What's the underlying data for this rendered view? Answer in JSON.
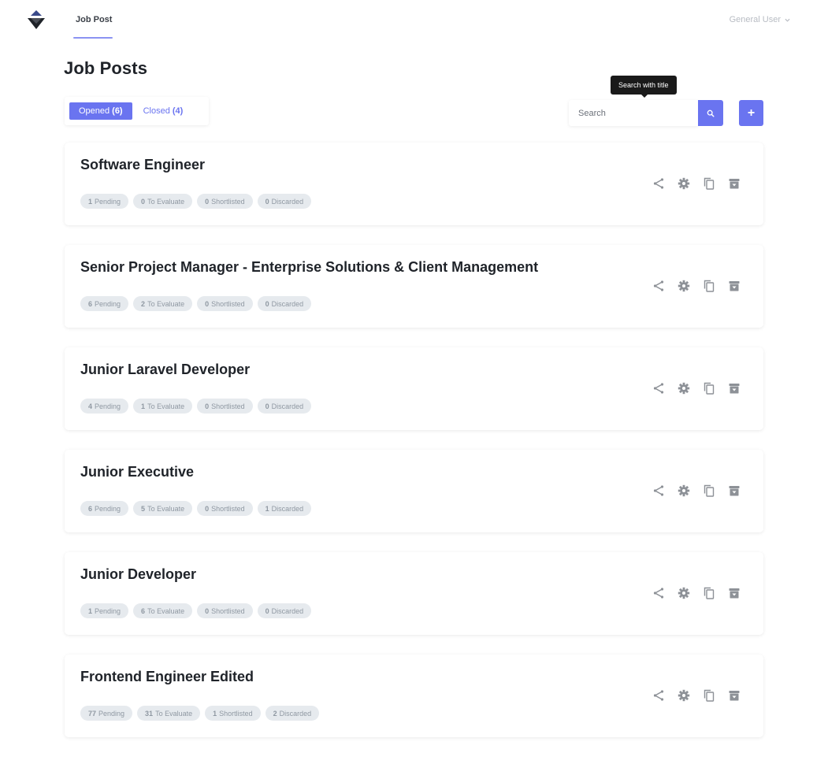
{
  "nav": {
    "tab_label": "Job Post",
    "user_label": "General User"
  },
  "page": {
    "title": "Job Posts"
  },
  "filters": {
    "opened_label": "Opened",
    "opened_count": "(6)",
    "closed_label": "Closed",
    "closed_count": "(4)"
  },
  "search": {
    "placeholder": "Search",
    "tooltip": "Search with title",
    "add_label": "+"
  },
  "jobs": [
    {
      "title": "Software Engineer",
      "badges": [
        {
          "count": "1",
          "label": "Pending"
        },
        {
          "count": "0",
          "label": "To Evaluate"
        },
        {
          "count": "0",
          "label": "Shortlisted"
        },
        {
          "count": "0",
          "label": "Discarded"
        }
      ]
    },
    {
      "title": "Senior Project Manager - Enterprise Solutions & Client Management",
      "badges": [
        {
          "count": "6",
          "label": "Pending"
        },
        {
          "count": "2",
          "label": "To Evaluate"
        },
        {
          "count": "0",
          "label": "Shortlisted"
        },
        {
          "count": "0",
          "label": "Discarded"
        }
      ]
    },
    {
      "title": "Junior Laravel Developer",
      "badges": [
        {
          "count": "4",
          "label": "Pending"
        },
        {
          "count": "1",
          "label": "To Evaluate"
        },
        {
          "count": "0",
          "label": "Shortlisted"
        },
        {
          "count": "0",
          "label": "Discarded"
        }
      ]
    },
    {
      "title": "Junior Executive",
      "badges": [
        {
          "count": "6",
          "label": "Pending"
        },
        {
          "count": "5",
          "label": "To Evaluate"
        },
        {
          "count": "0",
          "label": "Shortlisted"
        },
        {
          "count": "1",
          "label": "Discarded"
        }
      ]
    },
    {
      "title": "Junior Developer",
      "badges": [
        {
          "count": "1",
          "label": "Pending"
        },
        {
          "count": "6",
          "label": "To Evaluate"
        },
        {
          "count": "0",
          "label": "Shortlisted"
        },
        {
          "count": "0",
          "label": "Discarded"
        }
      ]
    },
    {
      "title": "Frontend Engineer Edited",
      "badges": [
        {
          "count": "77",
          "label": "Pending"
        },
        {
          "count": "31",
          "label": "To Evaluate"
        },
        {
          "count": "1",
          "label": "Shortlisted"
        },
        {
          "count": "2",
          "label": "Discarded"
        }
      ]
    }
  ],
  "icons": {
    "logo": "diamond-logo-icon",
    "user_menu": "chevron-down-icon",
    "search": "search-icon",
    "actions": [
      "share-icon",
      "gear-icon",
      "copy-icon",
      "archive-icon"
    ]
  },
  "colors": {
    "accent": "#6a74f0",
    "badge_bg": "#e6eaee",
    "badge_text": "#8f98a2",
    "icon_gray": "#8d9197",
    "tooltip_bg": "#1a1a1a"
  }
}
